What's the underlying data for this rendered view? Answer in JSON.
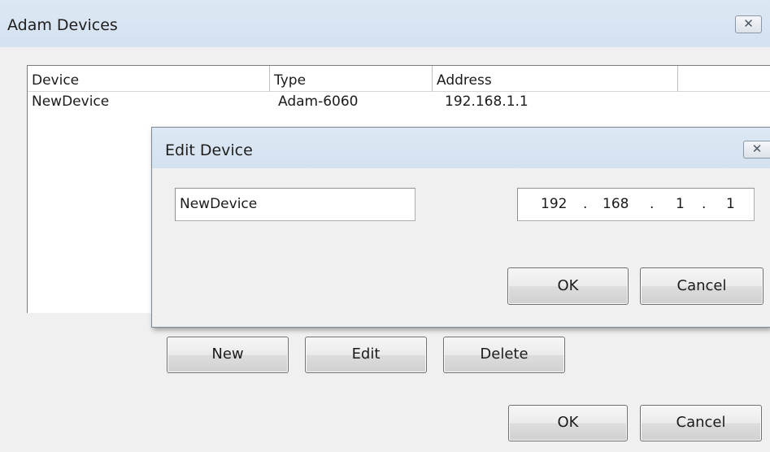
{
  "main_window": {
    "title": "Adam Devices",
    "close_glyph": "✕",
    "list": {
      "columns": [
        "Device",
        "Type",
        "Address",
        ""
      ],
      "rows": [
        {
          "device": "NewDevice",
          "type": "Adam-6060",
          "address": "192.168.1.1"
        }
      ]
    },
    "buttons": {
      "new": "New",
      "edit": "Edit",
      "delete": "Delete",
      "ok": "OK",
      "cancel": "Cancel"
    }
  },
  "edit_dialog": {
    "title": "Edit Device",
    "close_glyph": "✕",
    "name_value": "NewDevice",
    "ip_octets": [
      "192",
      "168",
      "1",
      "1"
    ],
    "ip_separator": ".",
    "buttons": {
      "ok": "OK",
      "cancel": "Cancel"
    }
  }
}
